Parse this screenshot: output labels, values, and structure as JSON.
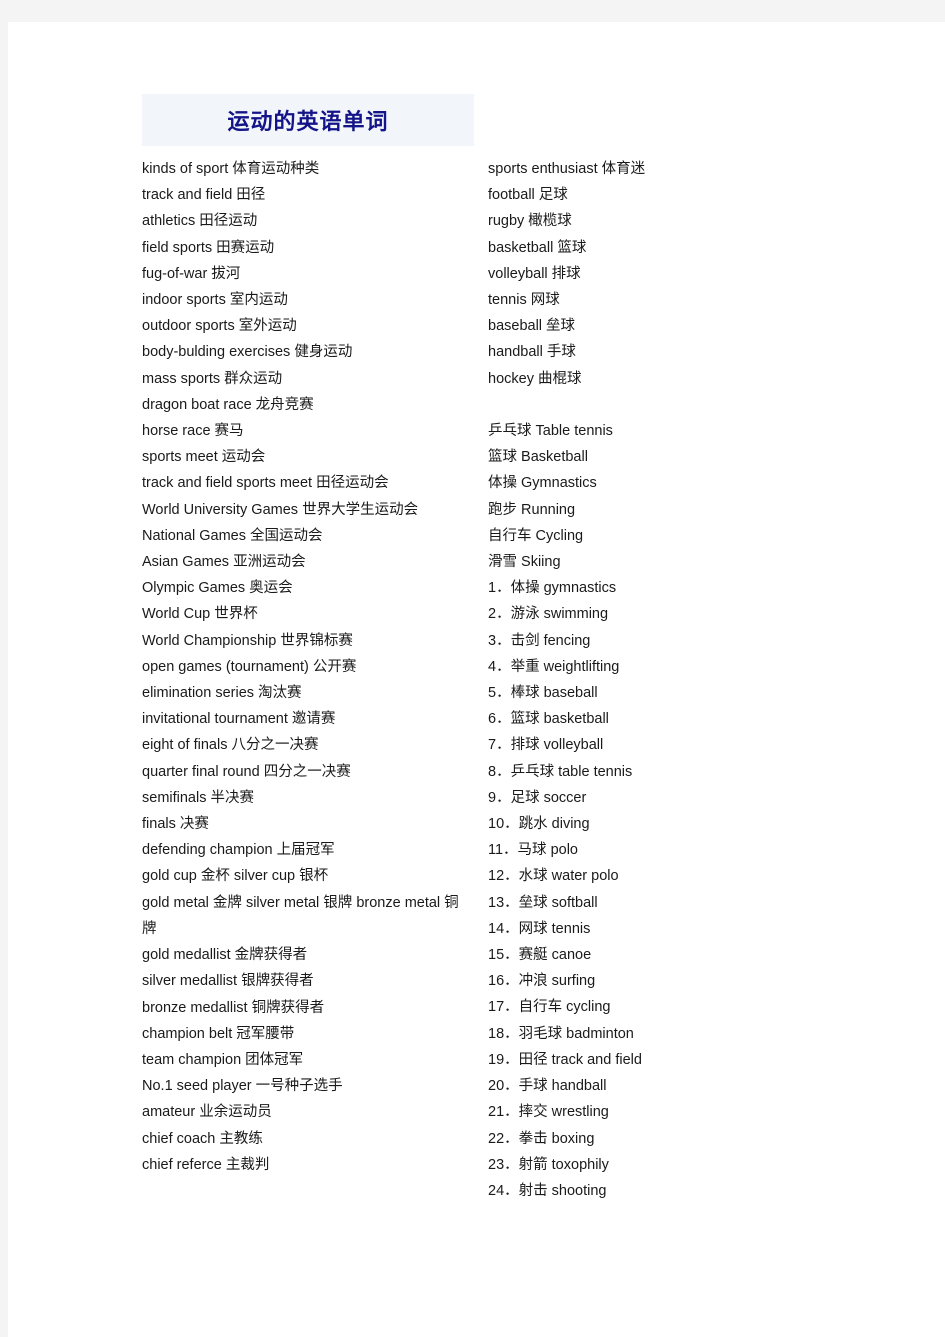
{
  "document": {
    "title": "运动的英语单词"
  },
  "left_column": [
    "kinds of sport  体育运动种类",
    "track and field 田径",
    "athletics  田径运动",
    "field sports  田赛运动",
    "fug-of-war  拔河",
    "indoor sports  室内运动",
    "outdoor sports  室外运动",
    "body-bulding exercises  健身运动",
    "mass sports  群众运动",
    "dragon boat race  龙舟竞赛",
    "horse race  赛马",
    "sports meet  运动会",
    "track and field sports meet  田径运动会",
    "World University Games 世界大学生运动会",
    "National Games  全国运动会",
    "Asian Games  亚洲运动会",
    "Olympic Games  奥运会",
    "World Cup  世界杯",
    "World Championship  世界锦标赛",
    "open games (tournament)  公开赛",
    "elimination series  淘汰赛",
    "invitational tournament  邀请赛",
    "eight of finals  八分之一决赛",
    "quarter final round  四分之一决赛",
    "semifinals  半决赛",
    "finals  决赛",
    "defending champion  上届冠军",
    "gold cup 金杯 silver cup  银杯",
    "gold metal 金牌 silver metal 银牌 bronze metal  铜牌",
    "gold medallist  金牌获得者",
    "silver medallist  银牌获得者",
    "bronze medallist  铜牌获得者",
    "champion belt  冠军腰带",
    "team champion  团体冠军",
    "No.1 seed player  一号种子选手",
    "amateur  业余运动员",
    "chief coach  主教练",
    "chief referce  主裁判"
  ],
  "right_column": [
    "sports enthusiast  体育迷",
    "football  足球",
    "rugby  橄榄球",
    "basketball  篮球",
    "volleyball  排球",
    "tennis  网球",
    "baseball  垒球",
    "handball  手球",
    "hockey  曲棍球",
    "",
    "乒乓球 Table tennis",
    "篮球 Basketball",
    "体操 Gymnastics",
    "跑步 Running",
    "自行车 Cycling",
    "滑雪 Skiing",
    "1．体操 gymnastics",
    "2．游泳 swimming",
    "3．击剑 fencing",
    "4．举重 weightlifting",
    "5．棒球 baseball",
    "6．篮球 basketball",
    "7．排球 volleyball",
    "8．乒乓球 table tennis",
    "9．足球 soccer",
    "10．跳水 diving",
    "11．马球 polo",
    "12．水球 water polo",
    "13．垒球 softball",
    "14．网球 tennis",
    "15．赛艇 canoe",
    "16．冲浪 surfing",
    "17．自行车 cycling",
    "18．羽毛球 badminton",
    "19．田径 track and field",
    "20．手球 handball",
    "21．摔交 wrestling",
    "22．拳击 boxing",
    "23．射箭 toxophily",
    "24．射击 shooting"
  ],
  "colors": {
    "title_text": "#141489",
    "title_banner_bg": "#f2f5fa",
    "page_bg": "#ffffff",
    "chrome_bg": "#f4f4f4",
    "body_text": "#1a1a1a"
  }
}
